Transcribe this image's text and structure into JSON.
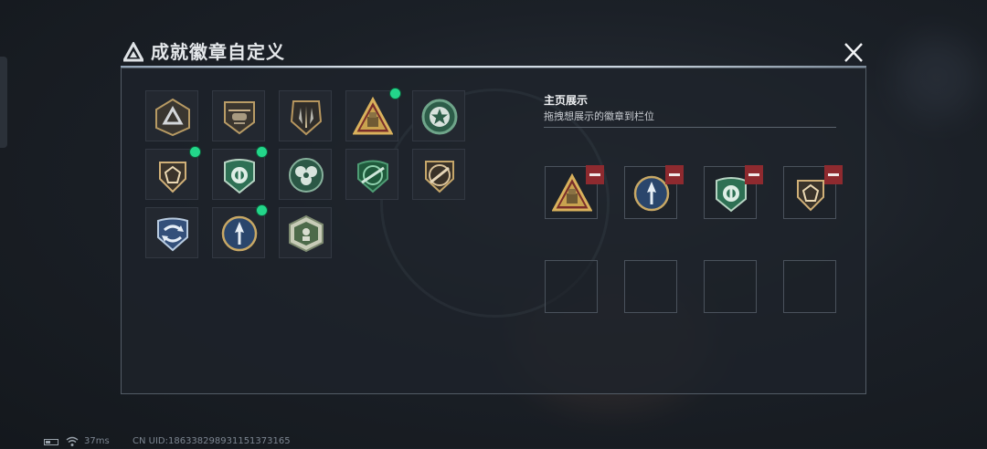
{
  "title": "成就徽章自定义",
  "close_icon": "close-icon",
  "badges": [
    {
      "id": "triangle-logo",
      "icon": "triangle-logo-badge",
      "new": false
    },
    {
      "id": "helicopter",
      "icon": "helicopter-badge",
      "new": false
    },
    {
      "id": "jets",
      "icon": "jets-badge",
      "new": false
    },
    {
      "id": "crate-warning",
      "icon": "crate-warning-badge",
      "new": true
    },
    {
      "id": "green-star",
      "icon": "green-star-badge",
      "new": false
    },
    {
      "id": "gold-gem",
      "icon": "gold-gem-badge",
      "new": true
    },
    {
      "id": "green-shield",
      "icon": "green-shield-badge",
      "new": true
    },
    {
      "id": "green-roses",
      "icon": "green-roses-badge",
      "new": false
    },
    {
      "id": "green-rifle",
      "icon": "green-rifle-badge",
      "new": false
    },
    {
      "id": "gold-rifle",
      "icon": "gold-rifle-badge",
      "new": false
    },
    {
      "id": "blue-arrows",
      "icon": "blue-arrows-badge",
      "new": false
    },
    {
      "id": "blue-arrow",
      "icon": "blue-arrow-badge",
      "new": true
    },
    {
      "id": "green-emblem",
      "icon": "green-emblem-badge",
      "new": false
    }
  ],
  "showcase": {
    "title": "主页展示",
    "subtitle": "拖拽想展示的徽章到栏位",
    "slots": [
      {
        "badge": "crate-warning",
        "remove_icon": "remove-icon"
      },
      {
        "badge": "blue-arrow",
        "remove_icon": "remove-icon"
      },
      {
        "badge": "green-shield",
        "remove_icon": "remove-icon"
      },
      {
        "badge": "gold-gem",
        "remove_icon": "remove-icon"
      },
      {
        "badge": null
      },
      {
        "badge": null
      },
      {
        "badge": null
      },
      {
        "badge": null
      }
    ]
  },
  "status": {
    "ping": "37ms",
    "uid": "CN UID:186338298931151373165"
  },
  "colors": {
    "new_dot": "#23d68a",
    "remove": "#8e2a2f",
    "accent_gold": "#c9a55a",
    "accent_green": "#2f7a55",
    "accent_blue": "#2d4f79"
  }
}
